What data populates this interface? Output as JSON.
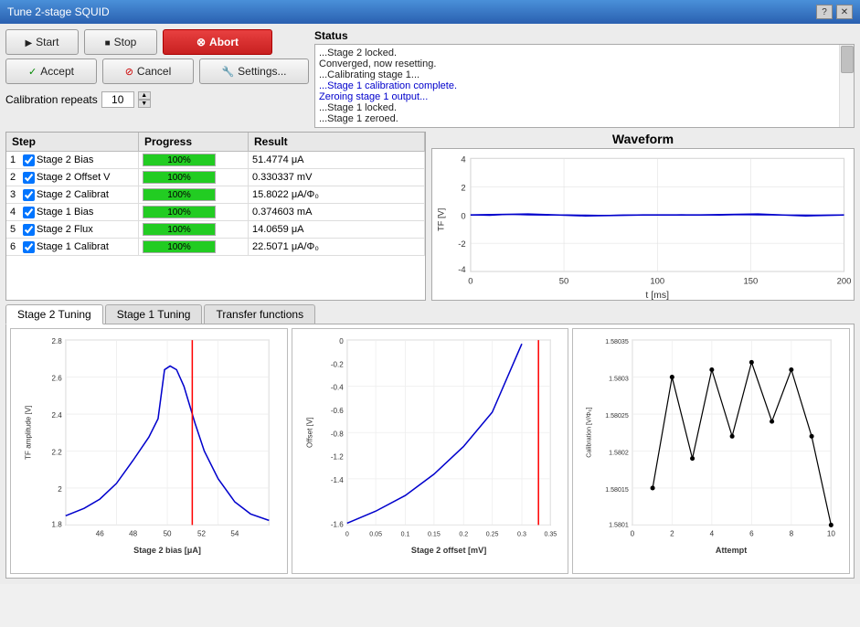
{
  "window": {
    "title": "Tune 2-stage SQUID"
  },
  "buttons": {
    "start": "Start",
    "stop": "Stop",
    "abort": "Abort",
    "accept": "Accept",
    "cancel": "Cancel",
    "settings": "Settings..."
  },
  "calibration": {
    "repeats_label": "Calibration repeats",
    "repeats_value": "10"
  },
  "status": {
    "label": "Status",
    "log": [
      "...Stage 2 locked.",
      "Converged, now resetting.",
      "...Calibrating stage 1...",
      "...Stage 1 calibration complete.",
      "Zeroing stage 1 output...",
      "...Stage 1 locked.",
      "...Stage 1 zeroed."
    ]
  },
  "table": {
    "headers": [
      "Step",
      "Progress",
      "Result"
    ],
    "rows": [
      {
        "num": "1",
        "checked": true,
        "step": "Stage 2 Bias",
        "progress": 100,
        "result": "51.4774 μA"
      },
      {
        "num": "2",
        "checked": true,
        "step": "Stage 2 Offset V",
        "progress": 100,
        "result": "0.330337 mV"
      },
      {
        "num": "3",
        "checked": true,
        "step": "Stage 2 Calibrat",
        "progress": 100,
        "result": "15.8022 μA/Φ₀"
      },
      {
        "num": "4",
        "checked": true,
        "step": "Stage 1 Bias",
        "progress": 100,
        "result": "0.374603 mA"
      },
      {
        "num": "5",
        "checked": true,
        "step": "Stage 2 Flux",
        "progress": 100,
        "result": "14.0659 μA"
      },
      {
        "num": "6",
        "checked": true,
        "step": "Stage 1 Calibrat",
        "progress": 100,
        "result": "22.5071 μA/Φ₀"
      }
    ]
  },
  "waveform": {
    "title": "Waveform",
    "xlabel": "t [ms]",
    "ylabel": "TF [V]",
    "xmin": 0,
    "xmax": 200,
    "ymin": -4,
    "ymax": 4,
    "xticks": [
      0,
      50,
      100,
      150,
      200
    ],
    "yticks": [
      4,
      2,
      0,
      -2,
      -4
    ]
  },
  "tabs": [
    {
      "id": "stage2-tuning",
      "label": "Stage 2 Tuning",
      "active": true
    },
    {
      "id": "stage1-tuning",
      "label": "Stage 1 Tuning",
      "active": false
    },
    {
      "id": "transfer-functions",
      "label": "Transfer functions",
      "active": false
    }
  ],
  "chart1": {
    "xlabel": "Stage 2 bias [μA]",
    "ylabel": "TF amplitude [V]",
    "xmin": 44,
    "xmax": 56,
    "ymin": 1.8,
    "ymax": 2.8,
    "redline_x": 51.5,
    "xticks": [
      46,
      48,
      50,
      52,
      54
    ]
  },
  "chart2": {
    "xlabel": "Stage 2 offset [mV]",
    "ylabel": "Offset [V]",
    "xmin": 0,
    "xmax": 0.35,
    "ymin": -1.6,
    "ymax": 0,
    "redline_x": 0.33,
    "xticks": [
      0,
      0.05,
      0.1,
      0.15,
      0.2,
      0.25,
      0.3,
      0.35
    ]
  },
  "chart3": {
    "xlabel": "Attempt",
    "ylabel": "Calibration [V/Φ₀]",
    "xmin": 0,
    "xmax": 10,
    "ymin": 1.5801,
    "ymax": 1.58035,
    "xticks": [
      0,
      2,
      4,
      6,
      8,
      10
    ],
    "yticks": [
      1.58035,
      1.5803,
      1.58025,
      1.5802,
      1.58015,
      1.5801
    ]
  }
}
